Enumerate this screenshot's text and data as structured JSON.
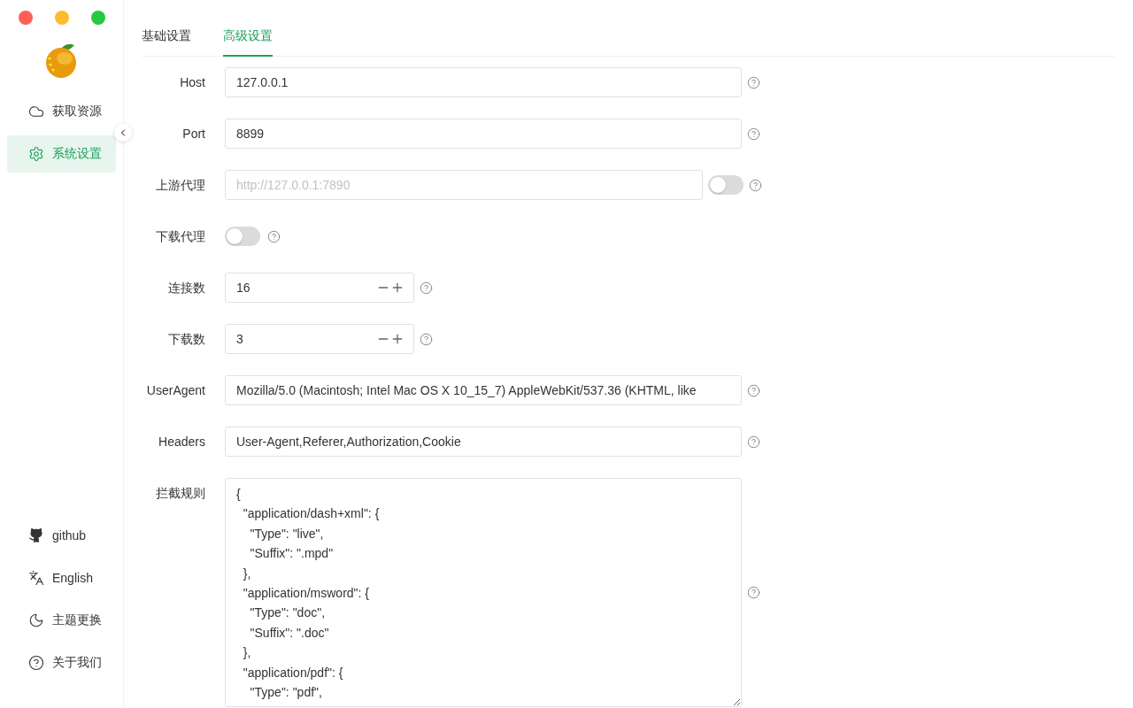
{
  "sidebar": {
    "nav": [
      {
        "label": "获取资源",
        "selected": false
      },
      {
        "label": "系统设置",
        "selected": true
      }
    ],
    "footer": [
      {
        "label": "github"
      },
      {
        "label": "English"
      },
      {
        "label": "主题更换"
      },
      {
        "label": "关于我们"
      }
    ]
  },
  "tabs": [
    {
      "label": "基础设置",
      "selected": false
    },
    {
      "label": "高级设置",
      "selected": true
    }
  ],
  "form": [
    {
      "kind": "text",
      "label": "Host",
      "value": "127.0.0.1"
    },
    {
      "kind": "text",
      "label": "Port",
      "value": "8899"
    },
    {
      "kind": "text_switch",
      "label": "上游代理",
      "placeholder": "http://127.0.0.1:7890",
      "on": false
    },
    {
      "kind": "switch",
      "label": "下载代理",
      "on": false
    },
    {
      "kind": "number",
      "label": "连接数",
      "value": "16"
    },
    {
      "kind": "number",
      "label": "下载数",
      "value": "3"
    },
    {
      "kind": "text",
      "label": "UserAgent",
      "value": "Mozilla/5.0 (Macintosh; Intel Mac OS X 10_15_7) AppleWebKit/537.36 (KHTML, like"
    },
    {
      "kind": "text",
      "label": "Headers",
      "value": "User-Agent,Referer,Authorization,Cookie"
    },
    {
      "kind": "textarea",
      "label": "拦截规则",
      "value": "{\n  \"application/dash+xml\": {\n    \"Type\": \"live\",\n    \"Suffix\": \".mpd\"\n  },\n  \"application/msword\": {\n    \"Type\": \"doc\",\n    \"Suffix\": \".doc\"\n  },\n  \"application/pdf\": {\n    \"Type\": \"pdf\","
    }
  ]
}
